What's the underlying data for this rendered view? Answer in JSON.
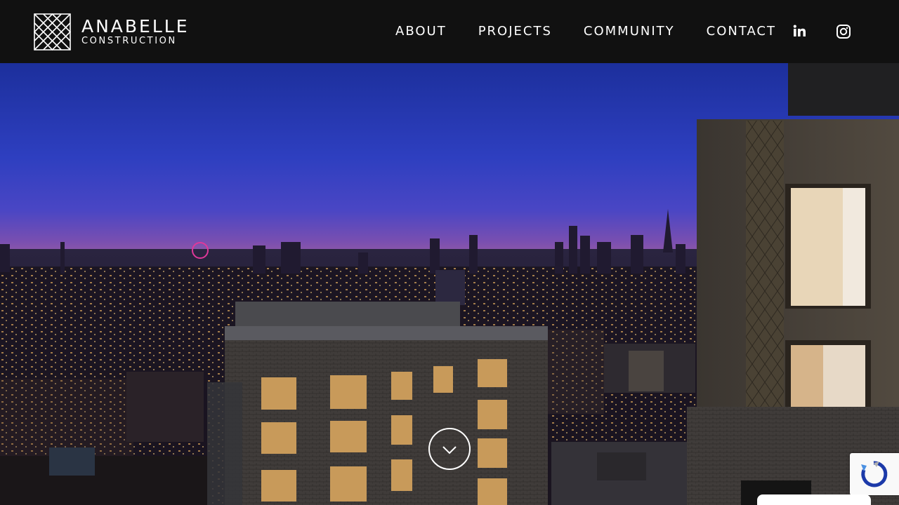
{
  "brand": {
    "name": "ANABELLE",
    "tagline": "CONSTRUCTION"
  },
  "nav": {
    "items": [
      {
        "label": "ABOUT"
      },
      {
        "label": "PROJECTS"
      },
      {
        "label": "COMMUNITY"
      },
      {
        "label": "CONTACT"
      }
    ]
  },
  "social": {
    "linkedin_icon": "linkedin-icon",
    "instagram_icon": "instagram-icon"
  },
  "hero": {
    "scroll_icon": "chevron-down-icon",
    "recaptcha_icon": "recaptcha-icon"
  },
  "colors": {
    "header_bg": "#111111",
    "sky_top": "#1e3bb0",
    "sky_horizon": "#7a4fb0",
    "text": "#ffffff"
  }
}
